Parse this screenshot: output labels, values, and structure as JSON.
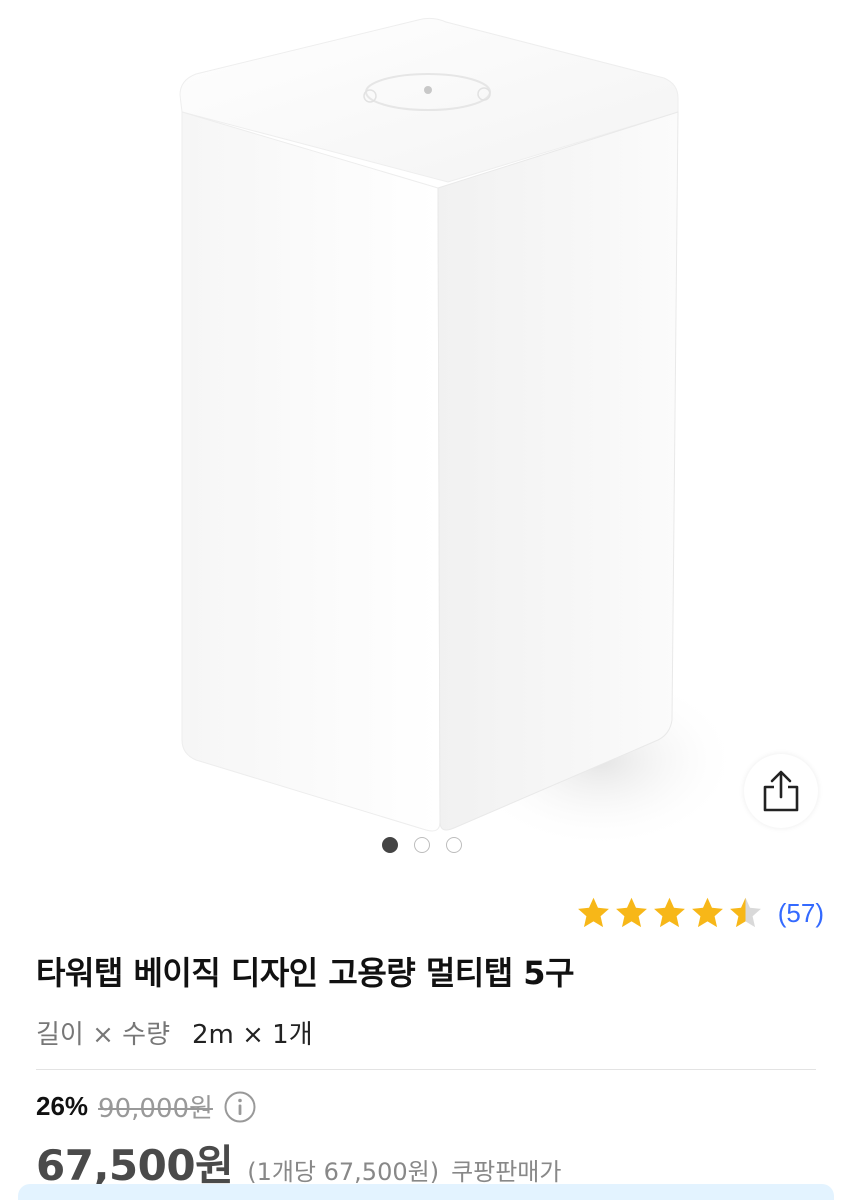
{
  "gallery": {
    "total_images": 3,
    "active_index": 0
  },
  "rating": {
    "stars": 4.5,
    "max_stars": 5,
    "review_count": "(57)"
  },
  "product": {
    "title": "타워탭 베이직 디자인 고용량 멀티탭 5구",
    "option_label": "길이 × 수량",
    "option_value": "2m × 1개"
  },
  "pricing": {
    "discount_rate": "26%",
    "original_price": "90,000원",
    "sale_price": "67,500원",
    "unit_price": "(1개당 67,500원)",
    "seller_type": "쿠팡판매가"
  },
  "colors": {
    "star": "#f7b718",
    "star_empty": "#d9d9d9",
    "link": "#346aff",
    "price": "#4a4a4a",
    "banner": "#e3f3ff"
  },
  "icons": {
    "share": "share-icon",
    "info": "info-icon",
    "star": "star-icon"
  }
}
